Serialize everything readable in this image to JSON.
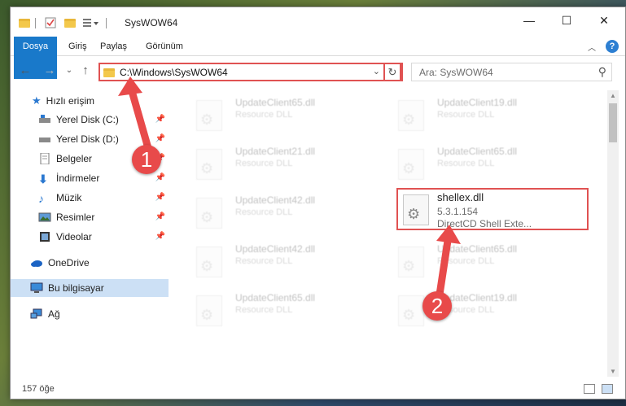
{
  "window": {
    "title": "SysWOW64",
    "controls": {
      "minimize": "—",
      "maximize": "☐",
      "close": "✕"
    }
  },
  "ribbon": {
    "tabs": [
      "Dosya",
      "Giriş",
      "Paylaş",
      "Görünüm"
    ],
    "help": "?"
  },
  "navigation": {
    "address_path": "C:\\Windows\\SysWOW64",
    "search_placeholder": "Ara: SysWOW64"
  },
  "sidebar": {
    "items": [
      {
        "label": "Hızlı erişim",
        "icon": "star-icon",
        "pinned": false
      },
      {
        "label": "Yerel Disk (C:)",
        "icon": "drive-icon",
        "pinned": true
      },
      {
        "label": "Yerel Disk (D:)",
        "icon": "drive-icon",
        "pinned": true
      },
      {
        "label": "Belgeler",
        "icon": "documents-icon",
        "pinned": true
      },
      {
        "label": "İndirmeler",
        "icon": "download-icon",
        "pinned": true
      },
      {
        "label": "Müzik",
        "icon": "music-icon",
        "pinned": true
      },
      {
        "label": "Resimler",
        "icon": "pictures-icon",
        "pinned": true
      },
      {
        "label": "Videolar",
        "icon": "videos-icon",
        "pinned": true
      },
      {
        "label": "OneDrive",
        "icon": "cloud-icon",
        "pinned": false
      },
      {
        "label": "Bu bilgisayar",
        "icon": "computer-icon",
        "pinned": false,
        "selected": true
      },
      {
        "label": "Ağ",
        "icon": "network-icon",
        "pinned": false
      }
    ]
  },
  "files": [
    {
      "name": "UpdateClient65.dll",
      "desc": "Resource DLL"
    },
    {
      "name": "UpdateClient19.dll",
      "desc": "Resource DLL"
    },
    {
      "name": "UpdateClient21.dll",
      "desc": "Resource DLL"
    },
    {
      "name": "UpdateClient65.dll",
      "desc": "Resource DLL"
    },
    {
      "name": "UpdateClient42.dll",
      "desc": "Resource DLL"
    },
    {
      "name": "shellex.dll",
      "version": "5.3.1.154",
      "desc": "DirectCD Shell Exte..."
    },
    {
      "name": "UpdateClient42.dll",
      "desc": "Resource DLL"
    },
    {
      "name": "UpdateClient65.dll",
      "desc": "Resource DLL"
    },
    {
      "name": "UpdateClient65.dll",
      "desc": "Resource DLL"
    },
    {
      "name": "UpdateClient19.dll",
      "desc": "Resource DLL"
    }
  ],
  "status": {
    "item_count": "157 öğe"
  },
  "annotations": {
    "step1": "1",
    "step2": "2",
    "color": "#e84a4a"
  }
}
